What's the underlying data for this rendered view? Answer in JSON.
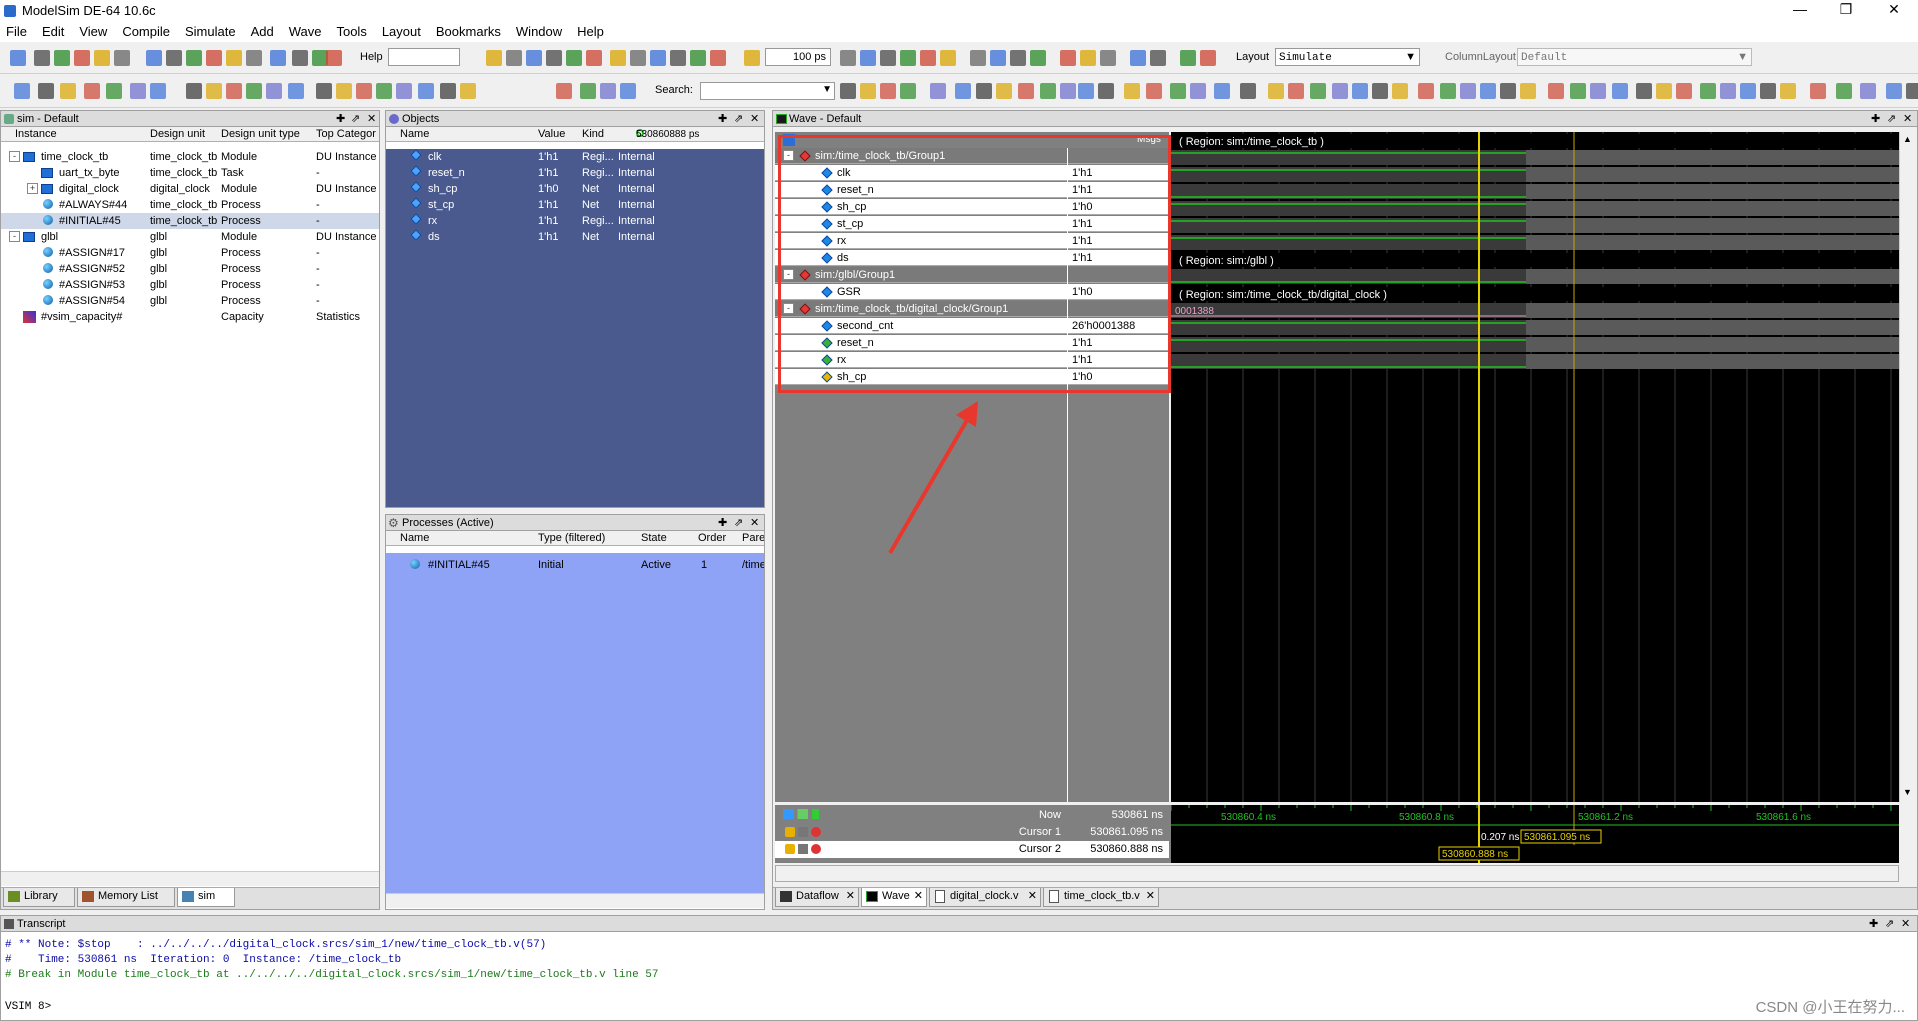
{
  "title": "ModelSim DE-64 10.6c",
  "menu": [
    "File",
    "Edit",
    "View",
    "Compile",
    "Simulate",
    "Add",
    "Wave",
    "Tools",
    "Layout",
    "Bookmarks",
    "Window",
    "Help"
  ],
  "toolbar": {
    "help_label": "Help",
    "run_length": "100 ps",
    "layout_label": "Layout",
    "layout_value": "Simulate",
    "column_layout_label": "ColumnLayout",
    "column_layout_value": "Default",
    "search_label": "Search:"
  },
  "sim_pane": {
    "title": "sim - Default",
    "columns": [
      "Instance",
      "Design unit",
      "Design unit type",
      "Top Categor"
    ],
    "rows": [
      {
        "instance": "time_clock_tb",
        "unit": "time_clock_tb",
        "type": "Module",
        "cat": "DU Instance",
        "level": 0,
        "expander": "-",
        "icon": "module"
      },
      {
        "instance": "uart_tx_byte",
        "unit": "time_clock_tb",
        "type": "Task",
        "cat": "-",
        "level": 1,
        "expander": "",
        "icon": "module"
      },
      {
        "instance": "digital_clock",
        "unit": "digital_clock",
        "type": "Module",
        "cat": "DU Instance",
        "level": 1,
        "expander": "+",
        "icon": "module"
      },
      {
        "instance": "#ALWAYS#44",
        "unit": "time_clock_tb",
        "type": "Process",
        "cat": "-",
        "level": 1,
        "expander": "",
        "icon": "process"
      },
      {
        "instance": "#INITIAL#45",
        "unit": "time_clock_tb",
        "type": "Process",
        "cat": "-",
        "level": 1,
        "expander": "",
        "icon": "process",
        "selected": true
      },
      {
        "instance": "glbl",
        "unit": "glbl",
        "type": "Module",
        "cat": "DU Instance",
        "level": 0,
        "expander": "-",
        "icon": "module"
      },
      {
        "instance": "#ASSIGN#17",
        "unit": "glbl",
        "type": "Process",
        "cat": "-",
        "level": 1,
        "expander": "",
        "icon": "process"
      },
      {
        "instance": "#ASSIGN#52",
        "unit": "glbl",
        "type": "Process",
        "cat": "-",
        "level": 1,
        "expander": "",
        "icon": "process"
      },
      {
        "instance": "#ASSIGN#53",
        "unit": "glbl",
        "type": "Process",
        "cat": "-",
        "level": 1,
        "expander": "",
        "icon": "process"
      },
      {
        "instance": "#ASSIGN#54",
        "unit": "glbl",
        "type": "Process",
        "cat": "-",
        "level": 1,
        "expander": "",
        "icon": "process"
      },
      {
        "instance": "#vsim_capacity#",
        "unit": "",
        "type": "Capacity",
        "cat": "Statistics",
        "level": 0,
        "expander": "",
        "icon": "capacity"
      }
    ],
    "tabs": [
      "Library",
      "Memory List",
      "sim"
    ]
  },
  "objects_pane": {
    "title": "Objects",
    "columns": [
      "Name",
      "Value",
      "Kind"
    ],
    "time_readout": "530860888 ps",
    "rows": [
      {
        "name": "clk",
        "value": "1'h1",
        "kind": "Regi...",
        "mode": "Internal"
      },
      {
        "name": "reset_n",
        "value": "1'h1",
        "kind": "Regi...",
        "mode": "Internal"
      },
      {
        "name": "sh_cp",
        "value": "1'h0",
        "kind": "Net",
        "mode": "Internal"
      },
      {
        "name": "st_cp",
        "value": "1'h1",
        "kind": "Net",
        "mode": "Internal"
      },
      {
        "name": "rx",
        "value": "1'h1",
        "kind": "Regi...",
        "mode": "Internal"
      },
      {
        "name": "ds",
        "value": "1'h1",
        "kind": "Net",
        "mode": "Internal"
      }
    ]
  },
  "processes_pane": {
    "title": "Processes (Active)",
    "columns": [
      "Name",
      "Type (filtered)",
      "State",
      "Order",
      "Pare"
    ],
    "rows": [
      {
        "name": "#INITIAL#45",
        "type": "Initial",
        "state": "Active",
        "order": "1",
        "parent": "/time"
      }
    ]
  },
  "wave": {
    "title": "Wave - Default",
    "msgs_label": "Msgs",
    "rows": [
      {
        "kind": "group",
        "name": "sim:/time_clock_tb/Group1",
        "value": "",
        "region": "( Region: sim:/time_clock_tb )"
      },
      {
        "kind": "signal",
        "name": "clk",
        "value": "1'h1",
        "icon": "reg"
      },
      {
        "kind": "signal",
        "name": "reset_n",
        "value": "1'h1",
        "icon": "reg"
      },
      {
        "kind": "signal",
        "name": "sh_cp",
        "value": "1'h0",
        "icon": "reg"
      },
      {
        "kind": "signal",
        "name": "st_cp",
        "value": "1'h1",
        "icon": "reg"
      },
      {
        "kind": "signal",
        "name": "rx",
        "value": "1'h1",
        "icon": "reg"
      },
      {
        "kind": "signal",
        "name": "ds",
        "value": "1'h1",
        "icon": "reg"
      },
      {
        "kind": "group",
        "name": "sim:/glbl/Group1",
        "value": "",
        "region": "( Region: sim:/glbl )"
      },
      {
        "kind": "signal",
        "name": "GSR",
        "value": "1'h0",
        "icon": "reg"
      },
      {
        "kind": "group",
        "name": "sim:/time_clock_tb/digital_clock/Group1",
        "value": "",
        "region": "( Region: sim:/time_clock_tb/digital_clock )"
      },
      {
        "kind": "signal",
        "name": "second_cnt",
        "value": "26'h0001388",
        "icon": "reg",
        "bus_text": "0001388"
      },
      {
        "kind": "signal",
        "name": "reset_n",
        "value": "1'h1",
        "icon": "in"
      },
      {
        "kind": "signal",
        "name": "rx",
        "value": "1'h1",
        "icon": "in"
      },
      {
        "kind": "signal",
        "name": "sh_cp",
        "value": "1'h0",
        "icon": "out"
      }
    ],
    "now_label": "Now",
    "now_value": "530861 ns",
    "cursor1_label": "Cursor 1",
    "cursor1_value": "530861.095 ns",
    "cursor2_label": "Cursor 2",
    "cursor2_value": "530860.888 ns",
    "ticks": [
      "530860.4 ns",
      "530860.8 ns",
      "530861.2 ns",
      "530861.6 ns"
    ],
    "delta_label": "0.207 ns",
    "cursor1_tag": "530861.095 ns",
    "cursor2_tag": "530860.888 ns"
  },
  "bottom_tabs": [
    "Dataflow",
    "Wave",
    "digital_clock.v",
    "time_clock_tb.v"
  ],
  "transcript": {
    "title": "Transcript",
    "lines": [
      "# ** Note: $stop    : ../../../../digital_clock.srcs/sim_1/new/time_clock_tb.v(57)",
      "#    Time: 530861 ns  Iteration: 0  Instance: /time_clock_tb",
      "# Break in Module time_clock_tb at ../../../../digital_clock.srcs/sim_1/new/time_clock_tb.v line 57"
    ],
    "prompt": "VSIM 8>"
  },
  "watermark": "CSDN @小王在努力...",
  "colors": {
    "annotation_red": "#e8372c",
    "wave_green": "#22c222",
    "cursor_yellow": "#e6d200",
    "objects_bg": "#4a5a8f",
    "processes_bg": "#8ea3f5"
  }
}
